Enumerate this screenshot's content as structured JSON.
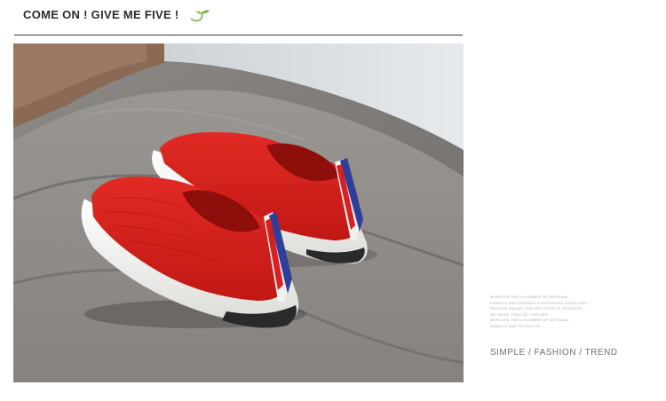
{
  "header": {
    "title": "COME ON ! GIVE ME FIVE !"
  },
  "side_text": {
    "lines": [
      "MORCKED HAS A NUMBER OF NATIONAL",
      "FABRICS AND PRODUCTS PROVIDING EXCELLENT",
      "FASHION AMONG THE DISCIPLES OF MORCKED",
      "WE MORE THAN 100 SPECIES",
      "MORCKED HAS A NUMBER OF NATIONAL",
      "FABRICS AND PRODUCTS"
    ],
    "tagline": "SIMPLE / FASHION / TREND"
  },
  "colors": {
    "shoe_red": "#d8201f",
    "sole_white": "#f4f4f2",
    "cushion_gray": "#7d7a77",
    "stripe_blue": "#2d3f9a"
  }
}
